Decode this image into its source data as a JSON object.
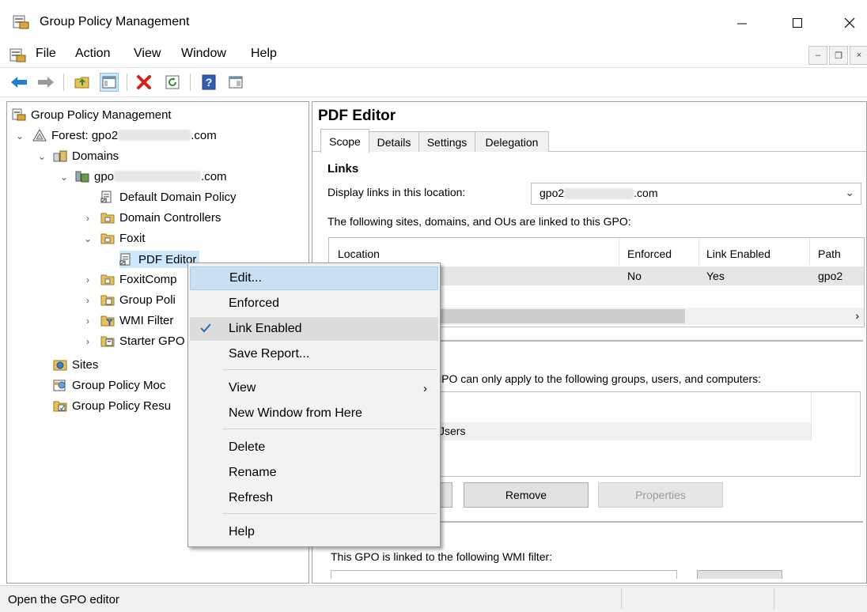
{
  "window": {
    "title": "Group Policy Management"
  },
  "menubar": {
    "items": [
      "File",
      "Action",
      "View",
      "Window",
      "Help"
    ]
  },
  "tree": {
    "root": "Group Policy Management",
    "forest_prefix": "Forest: gpo2",
    "forest_suffix": ".com",
    "domains": "Domains",
    "domain_prefix": "gpo",
    "domain_suffix": ".com",
    "default_policy": "Default Domain Policy",
    "domain_controllers": "Domain Controllers",
    "foxit": "Foxit",
    "pdf_editor": "PDF Editor",
    "foxitcomp": "FoxitComp",
    "group_policy_objects": "Group Poli",
    "wmi_filters": "WMI Filter",
    "starter_gpos": "Starter GPO",
    "sites": "Sites",
    "modeling": "Group Policy Moc",
    "results": "Group Policy Resu"
  },
  "details": {
    "title": "PDF Editor",
    "tabs": [
      "Scope",
      "Details",
      "Settings",
      "Delegation"
    ],
    "links_heading": "Links",
    "display_links_label": "Display links in this location:",
    "location_prefix": "gpo2",
    "location_suffix": ".com",
    "linked_text": "The following sites, domains, and OUs are linked to this GPO:",
    "columns": [
      "Location",
      "Enforced",
      "Link Enabled",
      "Path"
    ],
    "row": {
      "enforced": "No",
      "link_enabled": "Yes",
      "path": "gpo2"
    },
    "filter_text": "iPO can only apply to the following groups, users, and computers:",
    "filter_row": "Jsers",
    "remove_label": "Remove",
    "properties_label": "Properties",
    "wmi_text": "This GPO is linked to the following WMI filter:"
  },
  "context_menu": {
    "items": [
      "Edit...",
      "Enforced",
      "Link Enabled",
      "Save Report...",
      "View",
      "New Window from Here",
      "Delete",
      "Rename",
      "Refresh",
      "Help"
    ],
    "highlighted": "Edit...",
    "checked": "Link Enabled"
  },
  "status": {
    "text": "Open the GPO editor"
  },
  "colors": {
    "highlight": "#c7e0f4",
    "tree_selection": "#cce8ff",
    "back_arrow": "#1f7fd6"
  }
}
